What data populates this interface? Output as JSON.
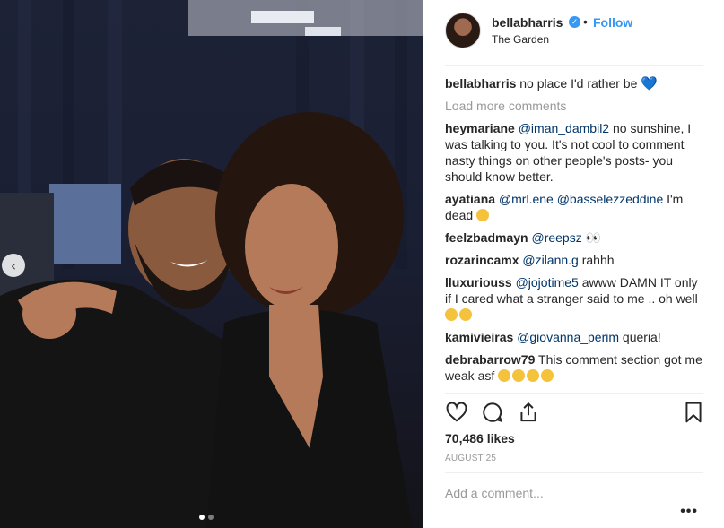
{
  "post": {
    "username": "bellabharris",
    "follow_label": "Follow",
    "bullet": "•",
    "location": "The Garden",
    "verified_glyph": "✓"
  },
  "caption": {
    "user": "bellabharris",
    "text": "no place I'd rather be"
  },
  "load_more_label": "Load more comments",
  "comments": [
    {
      "user": "heymariane",
      "mention": "@iman_dambil2",
      "text": " no sunshine, I was talking to you. It's not cool to comment nasty things on other people's posts- you should know better."
    },
    {
      "user": "ayatiana",
      "mention": "@mrl.ene @basselezzeddine",
      "text": " I'm dead"
    },
    {
      "user": "feelzbadmayn",
      "mention": "@reepsz",
      "text": " 👀"
    },
    {
      "user": "rozarincamx",
      "mention": "@zilann.g",
      "text": " rahhh"
    },
    {
      "user": "lluxuriouss",
      "mention": "@jojotime5",
      "text": " awww DAMN IT only if I cared what a stranger said to me .. oh well"
    },
    {
      "user": "kamivieiras",
      "mention": "@giovanna_perim",
      "text": " queria!"
    },
    {
      "user": "debrabarrow79",
      "mention": "",
      "text": "This comment section got me weak asf"
    }
  ],
  "likes": "70,486 likes",
  "date": "AUGUST 25",
  "add_comment_placeholder": "Add a comment...",
  "more_glyph": "•••",
  "prev_glyph": "‹",
  "colors": {
    "link": "#3897f0",
    "mention": "#003569",
    "muted": "#999999"
  }
}
